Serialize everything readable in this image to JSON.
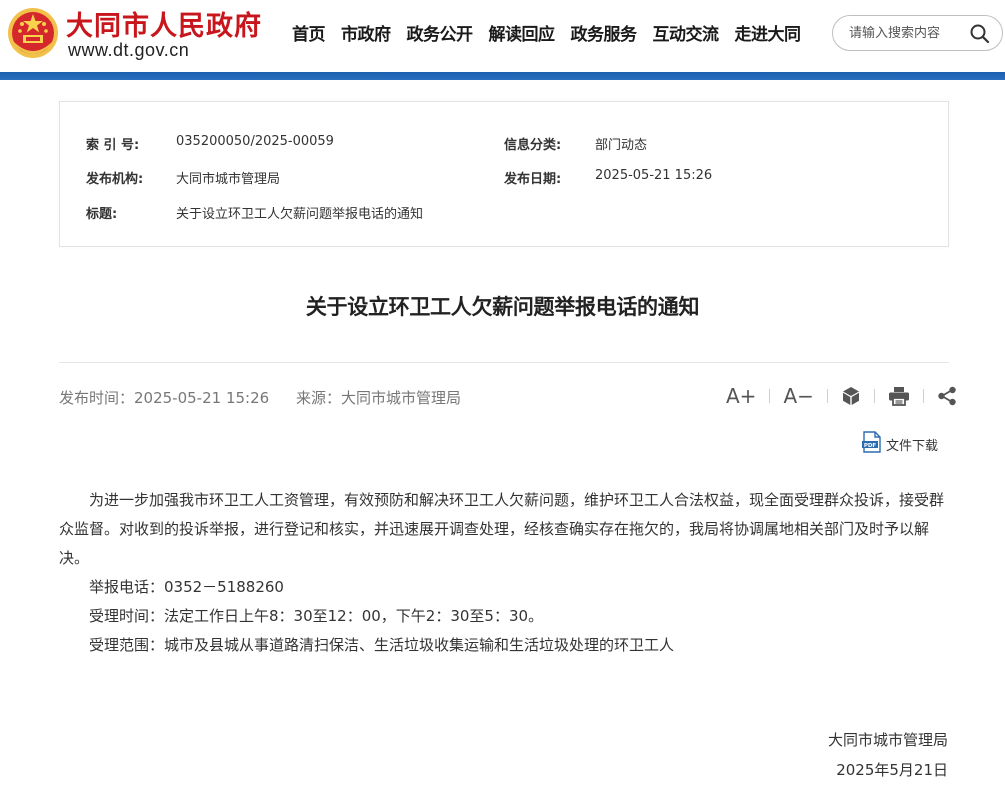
{
  "header": {
    "site_name": "大同市人民政府",
    "site_url": "www.dt.gov.cn",
    "nav": [
      "首页",
      "市政府",
      "政务公开",
      "解读回应",
      "政务服务",
      "互动交流",
      "走进大同"
    ],
    "search_placeholder": "请输入搜索内容"
  },
  "meta": {
    "index_label": "索 引 号:",
    "index_value": "035200050/2025-00059",
    "category_label": "信息分类:",
    "category_value": "部门动态",
    "publisher_label": "发布机构:",
    "publisher_value": "大同市城市管理局",
    "date_label": "发布日期:",
    "date_value": "2025-05-21 15:26",
    "title_label": "标题:",
    "title_value": "关于设立环卫工人欠薪问题举报电话的通知"
  },
  "article": {
    "title": "关于设立环卫工人欠薪问题举报电话的通知",
    "publish_time": "发布时间：2025-05-21 15:26",
    "source": "来源：大同市城市管理局",
    "tools": {
      "font_larger": "A+",
      "font_smaller": "A−"
    },
    "download_label": "文件下载",
    "paragraphs": [
      "为进一步加强我市环卫工人工资管理，有效预防和解决环卫工人欠薪问题，维护环卫工人合法权益，现全面受理群众投诉，接受群众监督。对收到的投诉举报，进行登记和核实，并迅速展开调查处理，经核查确实存在拖欠的，我局将协调属地相关部门及时予以解决。",
      "举报电话：0352－5188260",
      "受理时间：法定工作日上午8：30至12：00，下午2：30至5：30。",
      "受理范围：城市及县城从事道路清扫保洁、生活垃圾收集运输和生活垃圾处理的环卫工人"
    ],
    "signature_org": "大同市城市管理局",
    "signature_date": "2025年5月21日"
  },
  "colors": {
    "brand_red": "#c8161d",
    "bar_blue": "#1b5fae"
  }
}
